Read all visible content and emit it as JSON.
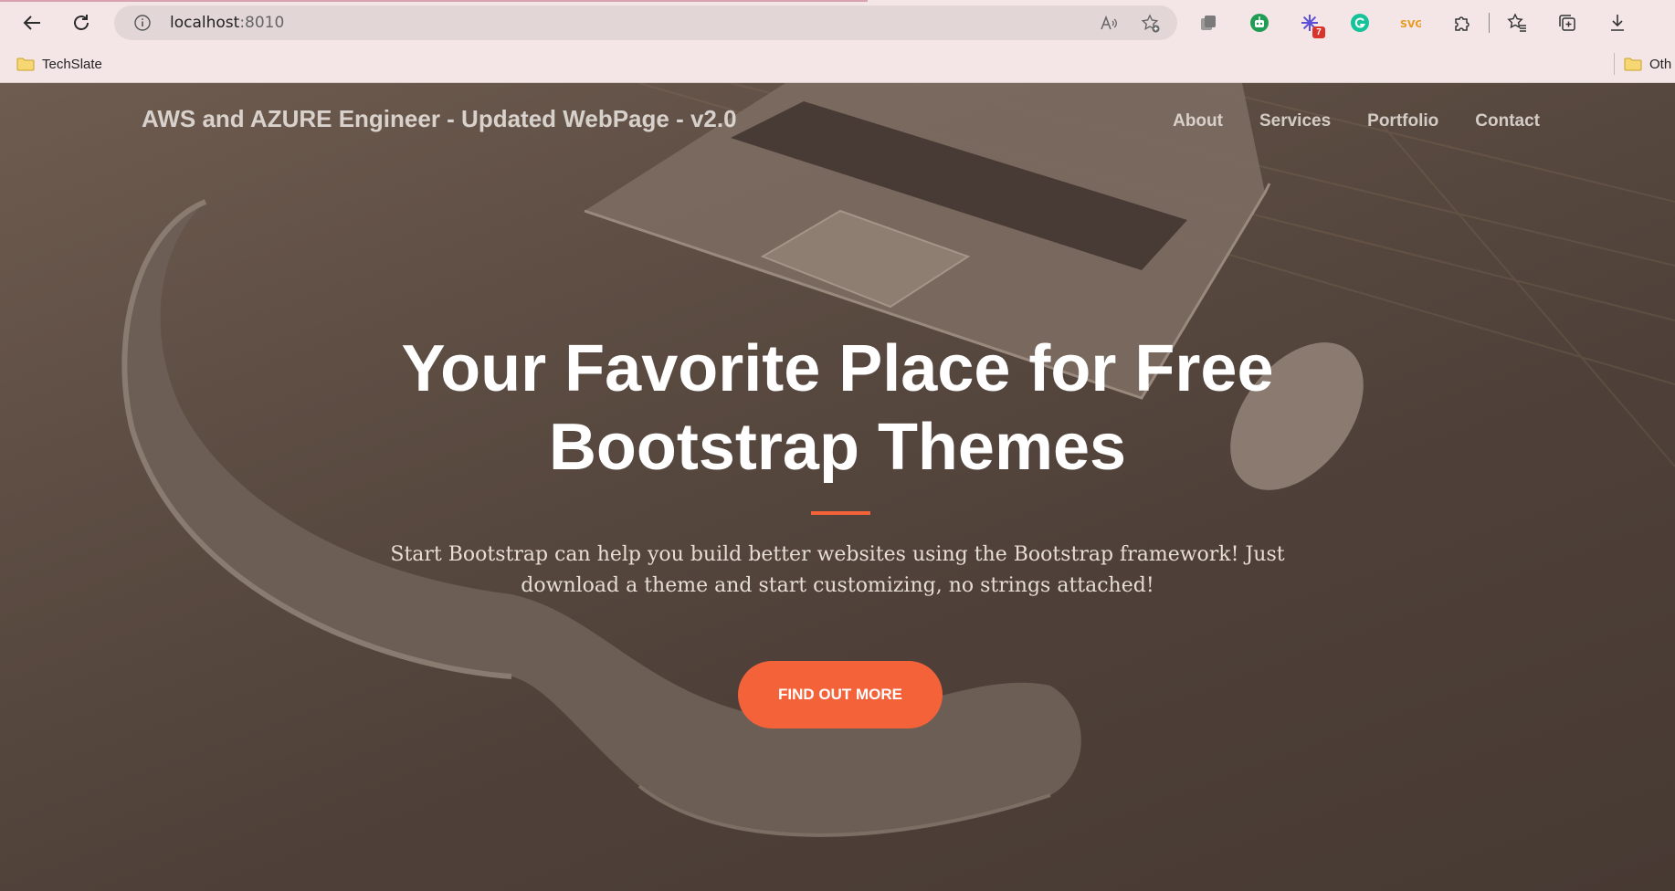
{
  "browser": {
    "url_host": "localhost",
    "url_port": ":8010",
    "extension_badge": "7",
    "bookmarks": [
      {
        "label": "TechSlate"
      },
      {
        "label": "Oth"
      }
    ]
  },
  "site": {
    "brand": "AWS and AZURE Engineer - Updated WebPage - v2.0",
    "nav": [
      "About",
      "Services",
      "Portfolio",
      "Contact"
    ],
    "hero_title_line1": "Your Favorite Place for Free",
    "hero_title_line2": "Bootstrap Themes",
    "lead": "Start Bootstrap can help you build better websites using the Bootstrap framework! Just download a theme and start customizing, no strings attached!",
    "cta": "FIND OUT MORE"
  },
  "colors": {
    "accent": "#f4623a",
    "chrome_bg": "#f4e6e6",
    "overlay": "#4c3f37"
  }
}
